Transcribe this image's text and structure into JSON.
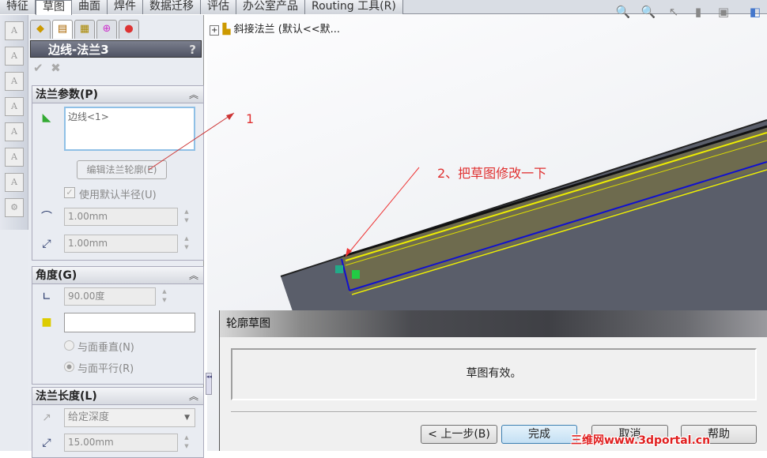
{
  "tabs": [
    "特征",
    "草图",
    "曲面",
    "焊件",
    "数据迁移",
    "评估",
    "办公室产品",
    "Routing 工具(R)"
  ],
  "active_tab": 1,
  "tree": {
    "item": "斜接法兰 (默认<<默..."
  },
  "pm": {
    "title": "边线-法兰3",
    "help": "?",
    "ok": "✔",
    "cancel": "✖",
    "flange_params": {
      "header": "法兰参数(P)",
      "edge_value": "边线<1>",
      "edit_button": "编辑法兰轮廓(E)",
      "use_default_radius": "使用默认半径(U)",
      "radius": "1.00mm",
      "gap": "1.00mm"
    },
    "angle": {
      "header": "角度(G)",
      "value": "90.00度",
      "normal_label": "与面垂直(N)",
      "parallel_label": "与面平行(R)",
      "selected": "parallel"
    },
    "length": {
      "header": "法兰长度(L)",
      "type": "给定深度",
      "depth": "15.00mm"
    }
  },
  "annotations": {
    "a1": "1",
    "a2": "2、把草图修改一下"
  },
  "dialog": {
    "title": "轮廓草图",
    "message": "草图有效。",
    "back": "< 上一步(B)",
    "finish": "完成",
    "cancel": "取消",
    "help": "帮助"
  },
  "watermark": "三维网www.3dportal.cn"
}
